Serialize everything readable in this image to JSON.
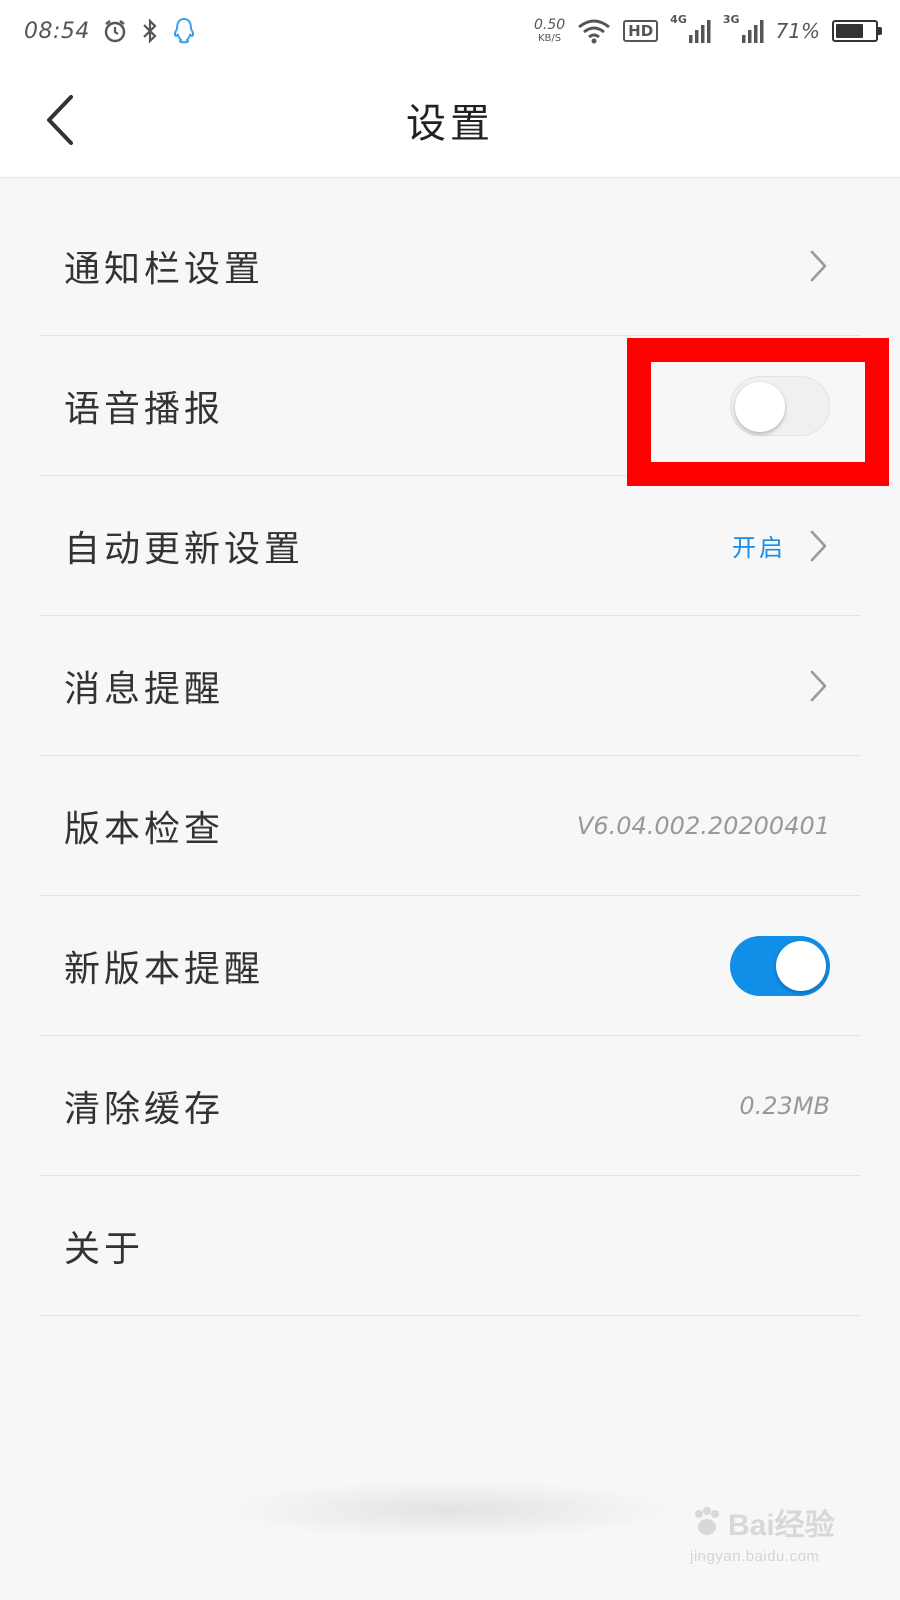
{
  "status_bar": {
    "time": "08:54",
    "net_speed_value": "0.50",
    "net_speed_unit": "KB/S",
    "hd_label": "HD",
    "sim1_tag": "4G",
    "sim2_tag": "3G",
    "battery_text": "71%",
    "battery_level": 0.71,
    "icons": [
      "alarm-icon",
      "bluetooth-icon",
      "qq-icon",
      "wifi-icon",
      "signal-icon",
      "battery-icon"
    ]
  },
  "header": {
    "title": "设置",
    "back_icon": "chevron-left-icon"
  },
  "settings": {
    "items": [
      {
        "label": "通知栏设置",
        "value": "",
        "control": "chevron"
      },
      {
        "label": "语音播报",
        "value": "",
        "control": "toggle",
        "toggle_state": "off"
      },
      {
        "label": "自动更新设置",
        "value": "开启",
        "control": "chevron"
      },
      {
        "label": "消息提醒",
        "value": "",
        "control": "chevron"
      },
      {
        "label": "版本检查",
        "value": "V6.04.002.20200401",
        "control": "none"
      },
      {
        "label": "新版本提醒",
        "value": "",
        "control": "toggle",
        "toggle_state": "on"
      },
      {
        "label": "清除缓存",
        "value": "0.23MB",
        "control": "none"
      },
      {
        "label": "关于",
        "value": "",
        "control": "none"
      }
    ]
  },
  "watermark": {
    "brand": "Bai经验",
    "url": "jingyan.baidu.com"
  },
  "colors": {
    "accent": "#1a8ce3",
    "toggle_on": "#118ee8",
    "highlight": "#ff0000",
    "background": "#f7f7f7"
  }
}
